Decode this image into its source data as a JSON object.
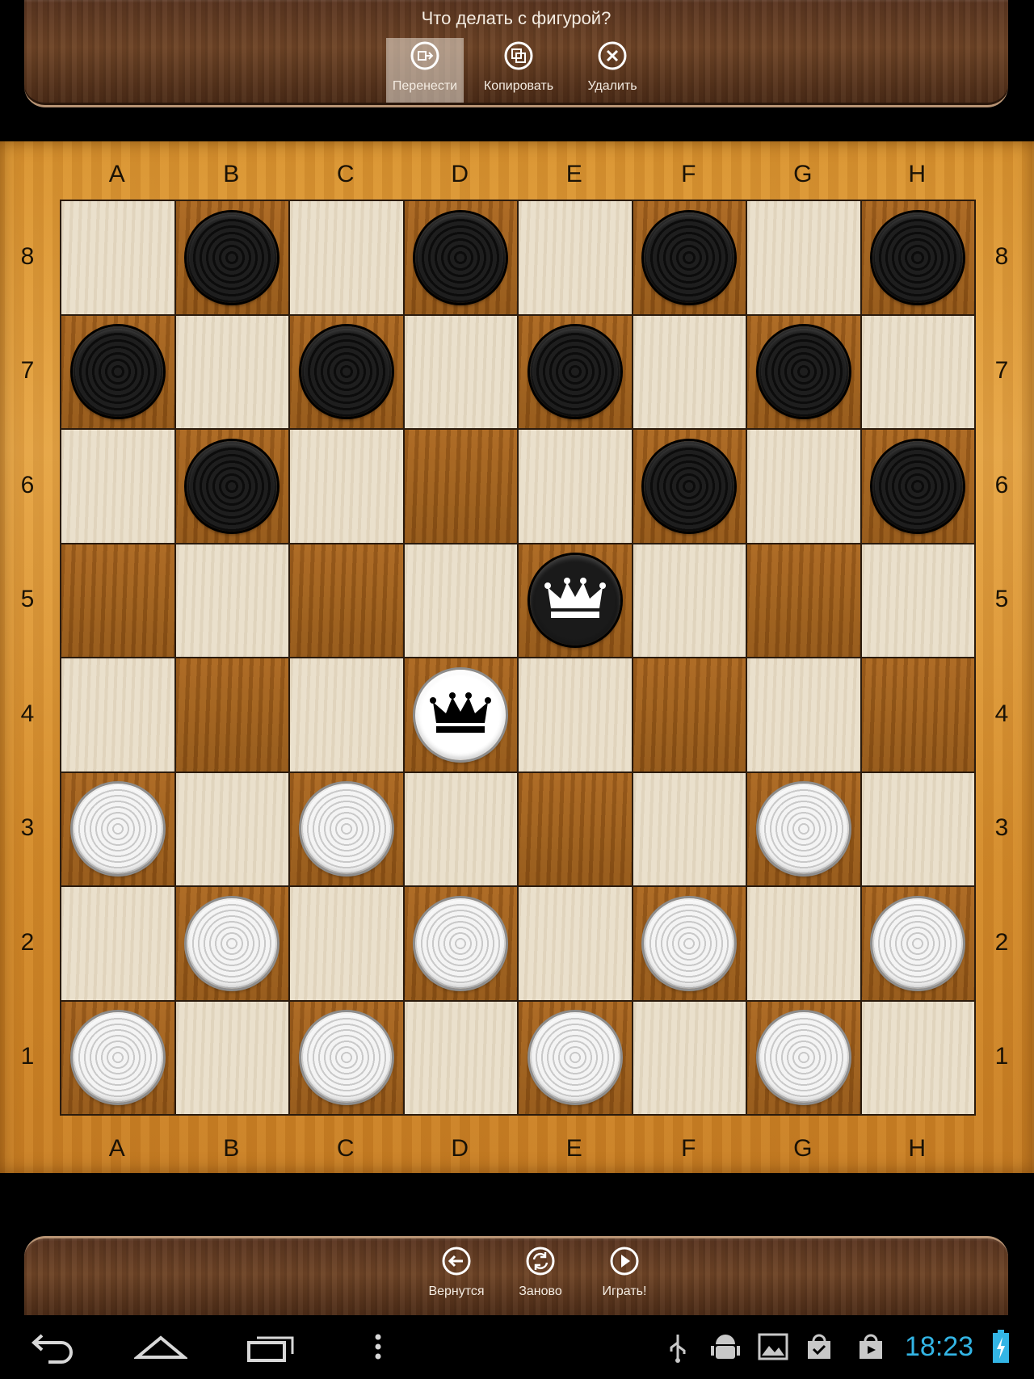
{
  "top_panel": {
    "title": "Что делать с фигурой?",
    "actions": [
      {
        "label": "Перенести",
        "icon": "move-icon",
        "selected": true
      },
      {
        "label": "Копировать",
        "icon": "copy-icon",
        "selected": false
      },
      {
        "label": "Удалить",
        "icon": "delete-icon",
        "selected": false
      }
    ]
  },
  "board": {
    "files": [
      "A",
      "B",
      "C",
      "D",
      "E",
      "F",
      "G",
      "H"
    ],
    "ranks": [
      "8",
      "7",
      "6",
      "5",
      "4",
      "3",
      "2",
      "1"
    ],
    "pieces": [
      {
        "square": "B8",
        "color": "black",
        "type": "man"
      },
      {
        "square": "D8",
        "color": "black",
        "type": "man"
      },
      {
        "square": "F8",
        "color": "black",
        "type": "man"
      },
      {
        "square": "H8",
        "color": "black",
        "type": "man"
      },
      {
        "square": "A7",
        "color": "black",
        "type": "man"
      },
      {
        "square": "C7",
        "color": "black",
        "type": "man"
      },
      {
        "square": "E7",
        "color": "black",
        "type": "man"
      },
      {
        "square": "G7",
        "color": "black",
        "type": "man"
      },
      {
        "square": "B6",
        "color": "black",
        "type": "man"
      },
      {
        "square": "F6",
        "color": "black",
        "type": "man"
      },
      {
        "square": "H6",
        "color": "black",
        "type": "man"
      },
      {
        "square": "E5",
        "color": "black",
        "type": "king"
      },
      {
        "square": "D4",
        "color": "white",
        "type": "king"
      },
      {
        "square": "A3",
        "color": "white",
        "type": "man"
      },
      {
        "square": "C3",
        "color": "white",
        "type": "man"
      },
      {
        "square": "G3",
        "color": "white",
        "type": "man"
      },
      {
        "square": "B2",
        "color": "white",
        "type": "man"
      },
      {
        "square": "D2",
        "color": "white",
        "type": "man"
      },
      {
        "square": "F2",
        "color": "white",
        "type": "man"
      },
      {
        "square": "H2",
        "color": "white",
        "type": "man"
      },
      {
        "square": "A1",
        "color": "white",
        "type": "man"
      },
      {
        "square": "C1",
        "color": "white",
        "type": "man"
      },
      {
        "square": "E1",
        "color": "white",
        "type": "man"
      },
      {
        "square": "G1",
        "color": "white",
        "type": "man"
      }
    ],
    "colors": {
      "light": "#e8dcc6",
      "dark": "#a8651f",
      "frame": "#dd9a38"
    }
  },
  "bottom_panel": {
    "actions": [
      {
        "label": "Вернутся",
        "icon": "back-arrow-icon"
      },
      {
        "label": "Заново",
        "icon": "restart-icon"
      },
      {
        "label": "Играть!",
        "icon": "play-icon"
      }
    ]
  },
  "status_bar": {
    "time": "18:23",
    "icons": [
      "back-icon",
      "home-icon",
      "recent-apps-icon",
      "overflow-menu-icon",
      "usb-icon",
      "android-debug-icon",
      "gallery-icon",
      "store-check-icon",
      "store-play-icon",
      "battery-charging-icon"
    ],
    "clock_color": "#33b5e5"
  }
}
